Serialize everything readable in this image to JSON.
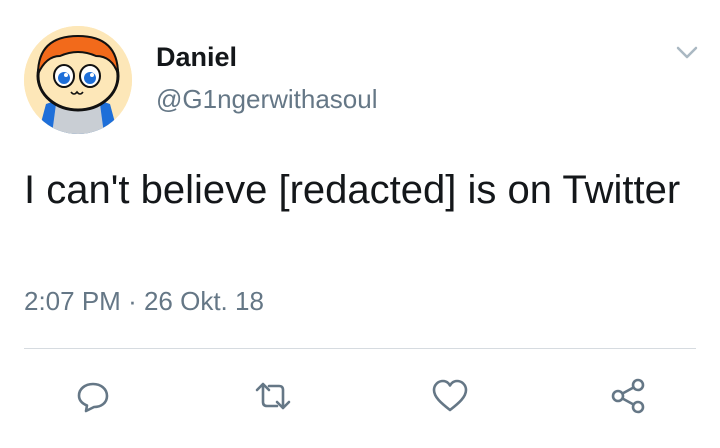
{
  "tweet": {
    "author_name": "Daniel",
    "author_handle": "@G1ngerwithasoul",
    "text": "I can't believe [redacted] is on Twitter",
    "time": "2:07 PM",
    "separator": "·",
    "date": "26 Okt. 18"
  },
  "icons": {
    "menu": "chevron-down-icon",
    "reply": "reply-icon",
    "retweet": "retweet-icon",
    "like": "heart-icon",
    "share": "share-icon"
  },
  "colors": {
    "text": "#14171a",
    "secondary": "#657786",
    "icon": "#657786",
    "divider": "#d6dbe0"
  }
}
